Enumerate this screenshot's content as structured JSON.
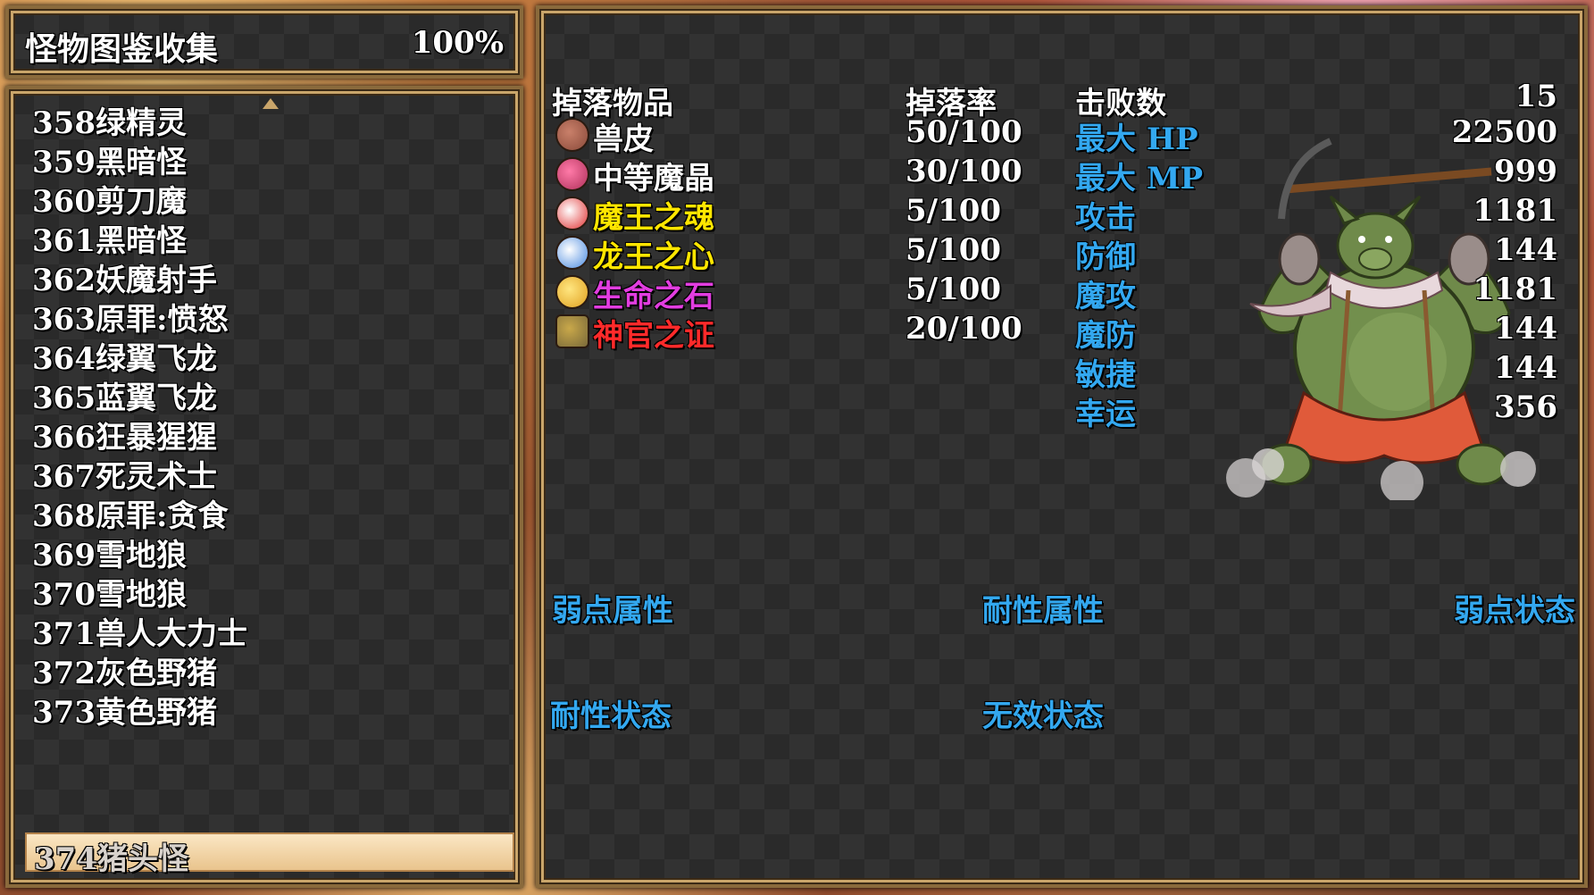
{
  "header": {
    "title": "怪物图鉴收集",
    "percent": "100%"
  },
  "list": {
    "items": [
      "358绿精灵",
      "359黑暗怪",
      "360剪刀魔",
      "361黑暗怪",
      "362妖魔射手",
      "363原罪:愤怒",
      "364绿翼飞龙",
      "365蓝翼飞龙",
      "366狂暴猩猩",
      "367死灵术士",
      "368原罪:贪食",
      "369雪地狼",
      "370雪地狼",
      "371兽人大力士",
      "372灰色野猪",
      "373黄色野猪"
    ],
    "selected": "374猪头怪"
  },
  "drops": {
    "header_item": "掉落物品",
    "header_rate": "掉落率",
    "rows": [
      {
        "name": "兽皮",
        "rate": "50/100",
        "color": "#ffffff",
        "icon": "fur-icon"
      },
      {
        "name": "中等魔晶",
        "rate": "30/100",
        "color": "#ffffff",
        "icon": "crystal-icon"
      },
      {
        "name": "魔王之魂",
        "rate": "5/100",
        "color": "#ffe600",
        "icon": "red-potion-icon"
      },
      {
        "name": "龙王之心",
        "rate": "5/100",
        "color": "#ffe600",
        "icon": "blue-potion-icon"
      },
      {
        "name": "生命之石",
        "rate": "5/100",
        "color": "#e23de0",
        "icon": "life-stone-icon"
      },
      {
        "name": "神官之证",
        "rate": "20/100",
        "color": "#ff2a2a",
        "icon": "badge-icon"
      }
    ]
  },
  "stats": {
    "defeats_label": "击败数",
    "defeats_value": "15",
    "rows": [
      {
        "label": "最大 HP",
        "value": "22500"
      },
      {
        "label": "最大 MP",
        "value": "999"
      },
      {
        "label": "攻击",
        "value": "1181"
      },
      {
        "label": "防御",
        "value": "144"
      },
      {
        "label": "魔攻",
        "value": "1181"
      },
      {
        "label": "魔防",
        "value": "144"
      },
      {
        "label": "敏捷",
        "value": "144"
      },
      {
        "label": "幸运",
        "value": "356"
      }
    ]
  },
  "attributes": {
    "weak_attr": "弱点属性",
    "resist_attr": "耐性属性",
    "weak_state": "弱点状态",
    "resist_state": "耐性状态",
    "immune_state": "无效状态"
  },
  "colors": {
    "label_blue": "#33a8f0",
    "frame_gold": "#c9a56a",
    "selection": "#f3d7a8"
  }
}
